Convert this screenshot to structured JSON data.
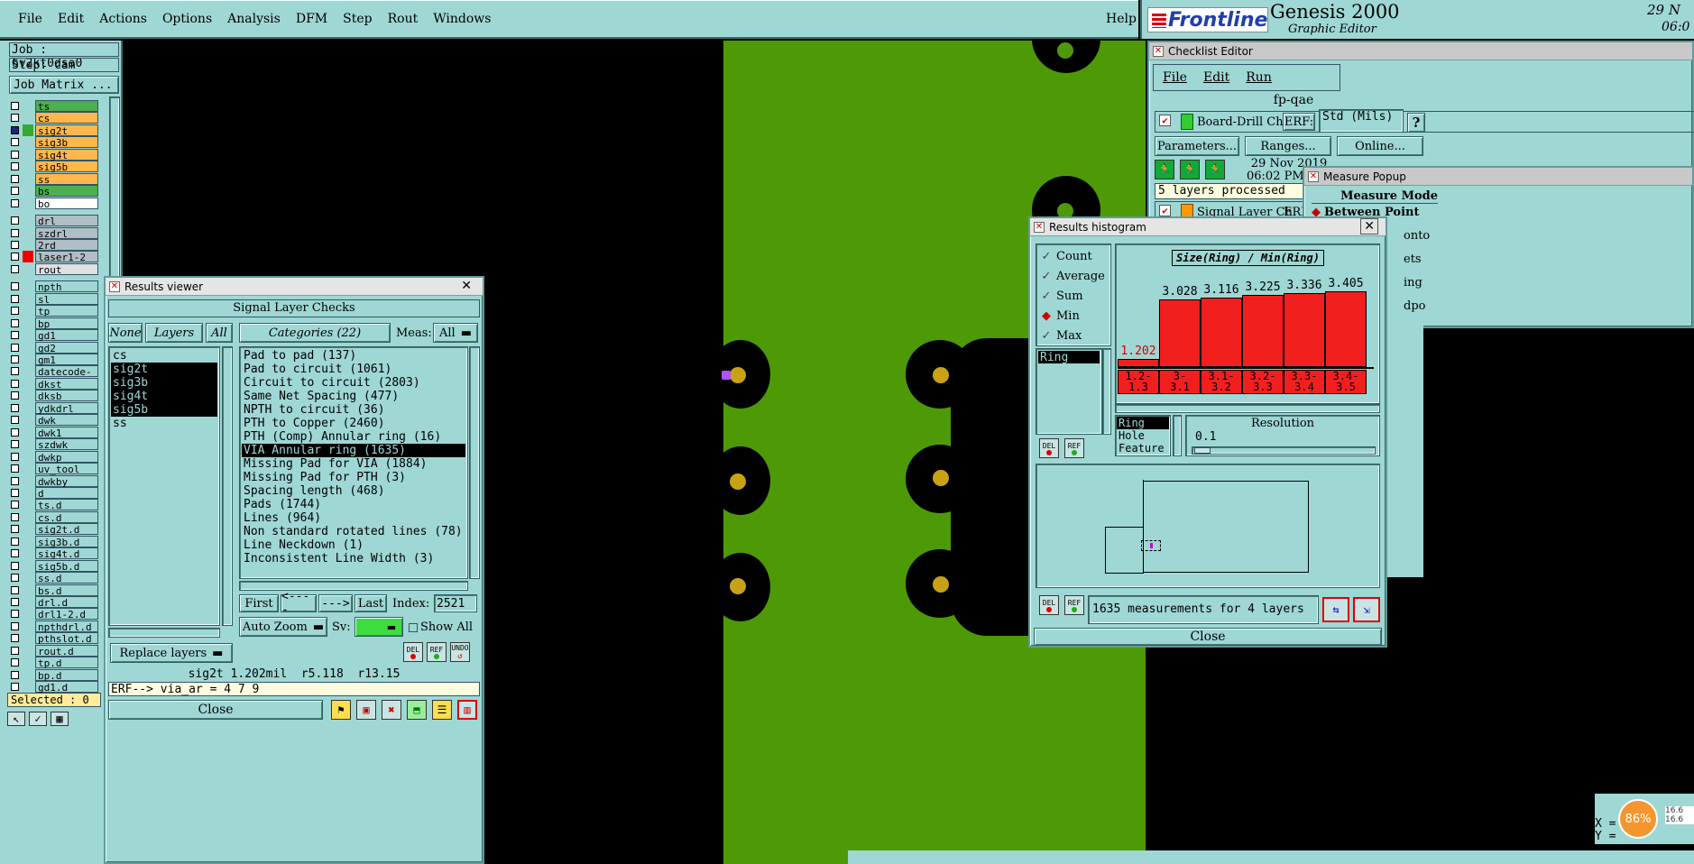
{
  "menu_bar": {
    "items": [
      "File",
      "Edit",
      "Actions",
      "Options",
      "Analysis",
      "DFM",
      "Step",
      "Rout",
      "Windows"
    ],
    "help": "Help",
    "brand": "Frontline",
    "product": "Genesis 2000",
    "subtitle": "Graphic Editor",
    "date": "29 N",
    "time": "06:0"
  },
  "job_panel": {
    "job": "Job : 6v2kt0dsa0",
    "step": "Step: cam",
    "job_matrix": "Job Matrix ...",
    "selected": "Selected : 0",
    "layers": [
      {
        "name": "ts",
        "color": "#4caf50",
        "active": false
      },
      {
        "name": "cs",
        "color": "#ffb74d",
        "active": false
      },
      {
        "name": "sig2t",
        "color": "#ffb74d",
        "active": true
      },
      {
        "name": "sig3b",
        "color": "#ffb74d",
        "active": false
      },
      {
        "name": "sig4t",
        "color": "#ffb74d",
        "active": false
      },
      {
        "name": "sig5b",
        "color": "#ffb74d",
        "active": false
      },
      {
        "name": "ss",
        "color": "#ffb74d",
        "active": false
      },
      {
        "name": "bs",
        "color": "#4caf50",
        "active": false
      },
      {
        "name": "bo",
        "color": "#ffffff",
        "active": false
      },
      {
        "name": "drl",
        "color": "#b0bec5",
        "active": false
      },
      {
        "name": "szdrl",
        "color": "#b0bec5",
        "active": false
      },
      {
        "name": "2rd",
        "color": "#b0bec5",
        "active": false
      },
      {
        "name": "laser1-2",
        "color": "#b0bec5",
        "active": false
      },
      {
        "name": "rout",
        "color": "#e0e0e0",
        "active": false
      },
      {
        "name": "npth",
        "color": "#9fd7d4",
        "active": false
      },
      {
        "name": "sl",
        "color": "#9fd7d4",
        "active": false
      },
      {
        "name": "tp",
        "color": "#9fd7d4",
        "active": false
      },
      {
        "name": "bp",
        "color": "#9fd7d4",
        "active": false
      },
      {
        "name": "gd1",
        "color": "#9fd7d4",
        "active": false
      },
      {
        "name": "gd2",
        "color": "#9fd7d4",
        "active": false
      },
      {
        "name": "gm1",
        "color": "#9fd7d4",
        "active": false
      },
      {
        "name": "datecode-pb",
        "color": "#9fd7d4",
        "active": false
      },
      {
        "name": "dkst",
        "color": "#9fd7d4",
        "active": false
      },
      {
        "name": "dksb",
        "color": "#9fd7d4",
        "active": false
      },
      {
        "name": "ydkdrl",
        "color": "#9fd7d4",
        "active": false
      },
      {
        "name": "dwk",
        "color": "#9fd7d4",
        "active": false
      },
      {
        "name": "dwk1",
        "color": "#9fd7d4",
        "active": false
      },
      {
        "name": "szdwk",
        "color": "#9fd7d4",
        "active": false
      },
      {
        "name": "dwkp",
        "color": "#9fd7d4",
        "active": false
      },
      {
        "name": "uv_tool",
        "color": "#9fd7d4",
        "active": false
      },
      {
        "name": "dwkby",
        "color": "#9fd7d4",
        "active": false
      },
      {
        "name": "d",
        "color": "#9fd7d4",
        "active": false
      },
      {
        "name": "ts.d",
        "color": "#9fd7d4",
        "active": false
      },
      {
        "name": "cs.d",
        "color": "#9fd7d4",
        "active": false
      },
      {
        "name": "sig2t.d",
        "color": "#9fd7d4",
        "active": false
      },
      {
        "name": "sig3b.d",
        "color": "#9fd7d4",
        "active": false
      },
      {
        "name": "sig4t.d",
        "color": "#9fd7d4",
        "active": false
      },
      {
        "name": "sig5b.d",
        "color": "#9fd7d4",
        "active": false
      },
      {
        "name": "ss.d",
        "color": "#9fd7d4",
        "active": false
      },
      {
        "name": "bs.d",
        "color": "#9fd7d4",
        "active": false
      },
      {
        "name": "drl.d",
        "color": "#9fd7d4",
        "active": false
      },
      {
        "name": "drl1-2.d",
        "color": "#9fd7d4",
        "active": false
      },
      {
        "name": "npthdrl.d",
        "color": "#9fd7d4",
        "active": false
      },
      {
        "name": "pthslot.d",
        "color": "#9fd7d4",
        "active": false
      },
      {
        "name": "rout.d",
        "color": "#9fd7d4",
        "active": false
      },
      {
        "name": "tp.d",
        "color": "#9fd7d4",
        "active": false
      },
      {
        "name": "bp.d",
        "color": "#9fd7d4",
        "active": false
      },
      {
        "name": "gd1.d",
        "color": "#9fd7d4",
        "active": false
      }
    ]
  },
  "results_viewer": {
    "title": "Results viewer",
    "header": "Signal Layer Checks",
    "none_btn": "None",
    "layers_btn": "Layers",
    "all_btn": "All",
    "categories_btn": "Categories (22)",
    "meas_label": "Meas:",
    "meas_value": "All",
    "layer_list": [
      {
        "name": "cs",
        "selected": false
      },
      {
        "name": "sig2t",
        "selected": true
      },
      {
        "name": "sig3b",
        "selected": true
      },
      {
        "name": "sig4t",
        "selected": true
      },
      {
        "name": "sig5b",
        "selected": true
      },
      {
        "name": "ss",
        "selected": false
      }
    ],
    "categories": [
      {
        "label": "Pad to pad (137)",
        "selected": false
      },
      {
        "label": "Pad to circuit (1061)",
        "selected": false
      },
      {
        "label": "Circuit to circuit (2803)",
        "selected": false
      },
      {
        "label": "Same Net Spacing (477)",
        "selected": false
      },
      {
        "label": "NPTH to circuit (36)",
        "selected": false
      },
      {
        "label": "PTH to Copper (2460)",
        "selected": false
      },
      {
        "label": "PTH (Comp) Annular ring (16)",
        "selected": false
      },
      {
        "label": "VIA Annular ring (1635)",
        "selected": true
      },
      {
        "label": "Missing Pad for VIA (1884)",
        "selected": false
      },
      {
        "label": "Missing Pad for PTH (3)",
        "selected": false
      },
      {
        "label": "Spacing length (468)",
        "selected": false
      },
      {
        "label": "Pads (1744)",
        "selected": false
      },
      {
        "label": "Lines (964)",
        "selected": false
      },
      {
        "label": "Non standard rotated lines (78)",
        "selected": false
      },
      {
        "label": "Line Neckdown (1)",
        "selected": false
      },
      {
        "label": "Inconsistent Line Width (3)",
        "selected": false
      }
    ],
    "first": "First",
    "prev": "<----",
    "next": "--->",
    "last": "Last",
    "index_label": "Index:",
    "index_value": "2521",
    "auto_zoom": "Auto Zoom",
    "sv_label": "Sv:",
    "show_all": "Show All",
    "replace_layers": "Replace layers",
    "del": "DEL",
    "ref": "REF",
    "undo": "UNDO",
    "status": "sig2t 1.202mil  r5.118  r13.15",
    "erf": "ERF--> via_ar = 4 7 9",
    "close": "Close"
  },
  "checklist_editor": {
    "title": "Checklist Editor",
    "menu": [
      "File",
      "Edit",
      "Run"
    ],
    "name": "fp-qae",
    "check1": "Board-Drill Che",
    "erf_label": "ERF:",
    "erf_value": "Std (Mils)",
    "question": "?",
    "parameters": "Parameters...",
    "ranges": "Ranges...",
    "online": "Online...",
    "date": "29 Nov 2019",
    "time": "06:02 PM -",
    "processed": "5 layers processed",
    "check2": "Signal Layer Ch",
    "erf2": "ERF"
  },
  "measure_popup": {
    "title": "Measure Popup",
    "mode": "Measure Mode",
    "option": "Between Point",
    "frag1": "onto",
    "frag2": "ets",
    "frag3": "ing",
    "frag4": "dpo"
  },
  "histogram": {
    "title": "Results histogram",
    "options": [
      {
        "label": "Count",
        "active": false
      },
      {
        "label": "Average",
        "active": false
      },
      {
        "label": "Sum",
        "active": false
      },
      {
        "label": "Min",
        "active": true
      },
      {
        "label": "Max",
        "active": false
      }
    ],
    "list_item": "Ring",
    "chart_title": "Size(Ring) / Min(Ring)",
    "groupby": [
      "Ring",
      "Hole",
      "Feature"
    ],
    "resolution_label": "Resolution",
    "resolution_value": "0.1",
    "summary": "1635 measurements for 4 layers",
    "del": "DEL",
    "ref": "REF",
    "close": "Close"
  },
  "chart_data": {
    "type": "bar",
    "title": "Size(Ring) / Min(Ring)",
    "categories": [
      "1.2-\n1.3",
      "3-\n3.1",
      "3.1-\n3.2",
      "3.2-\n3.3",
      "3.3-\n3.4",
      "3.4-\n3.5"
    ],
    "values": [
      1.202,
      3.028,
      3.116,
      3.225,
      3.336,
      3.405
    ],
    "labels": [
      "1.202",
      "3.028",
      "3.116",
      "3.225",
      "3.336",
      "3.405"
    ],
    "bar_color": "#f21f1f",
    "first_label_color": "#d00000"
  },
  "status_corner": {
    "x_label": "X =",
    "y_label": "Y =",
    "percent": "86%",
    "net1": "16.6",
    "net2": "16.6"
  },
  "colors": {
    "panel": "#9fd7d4",
    "copper": "#4e9a06",
    "background": "#000000",
    "pad_center": "#c8a214"
  }
}
